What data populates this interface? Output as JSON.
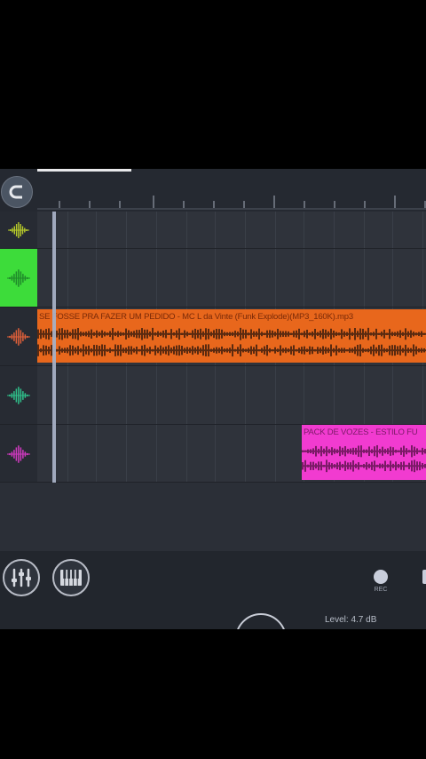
{
  "toolbar": {
    "magnet_icon": "magnet-icon"
  },
  "tracks": [
    {
      "id": "t1",
      "icon_color": "#b8cc2a",
      "header_bg": "#272b33",
      "clip": null
    },
    {
      "id": "t2",
      "icon_color": "#1f8a2a",
      "header_bg": "#3ddc3a",
      "clip": null
    },
    {
      "id": "t3",
      "icon_color": "#e0603a",
      "header_bg": "#272b33",
      "clip": {
        "label": "SE FOSSE PRA FAZER UM PEDIDO - MC L da Vinte (Funk Explode)(MP3_160K).mp3",
        "color": "#e8671c",
        "text_color": "#7a2a08",
        "wave_color": "#5a2a10"
      }
    },
    {
      "id": "t4",
      "icon_color": "#2fbf8a",
      "header_bg": "#272b33",
      "clip": null
    },
    {
      "id": "t5",
      "icon_color": "#d03ac0",
      "header_bg": "#272b33",
      "clip": {
        "label": "PACK DE VOZES - ESTILO FU",
        "color": "#f13bd0",
        "text_color": "#7a1a66",
        "wave_color": "#7a1a66"
      }
    }
  ],
  "controls": {
    "mixer_icon": "mixer-icon",
    "piano_icon": "piano-icon",
    "rec_label": "REC",
    "level_text": "Level: 4.7 dB"
  }
}
